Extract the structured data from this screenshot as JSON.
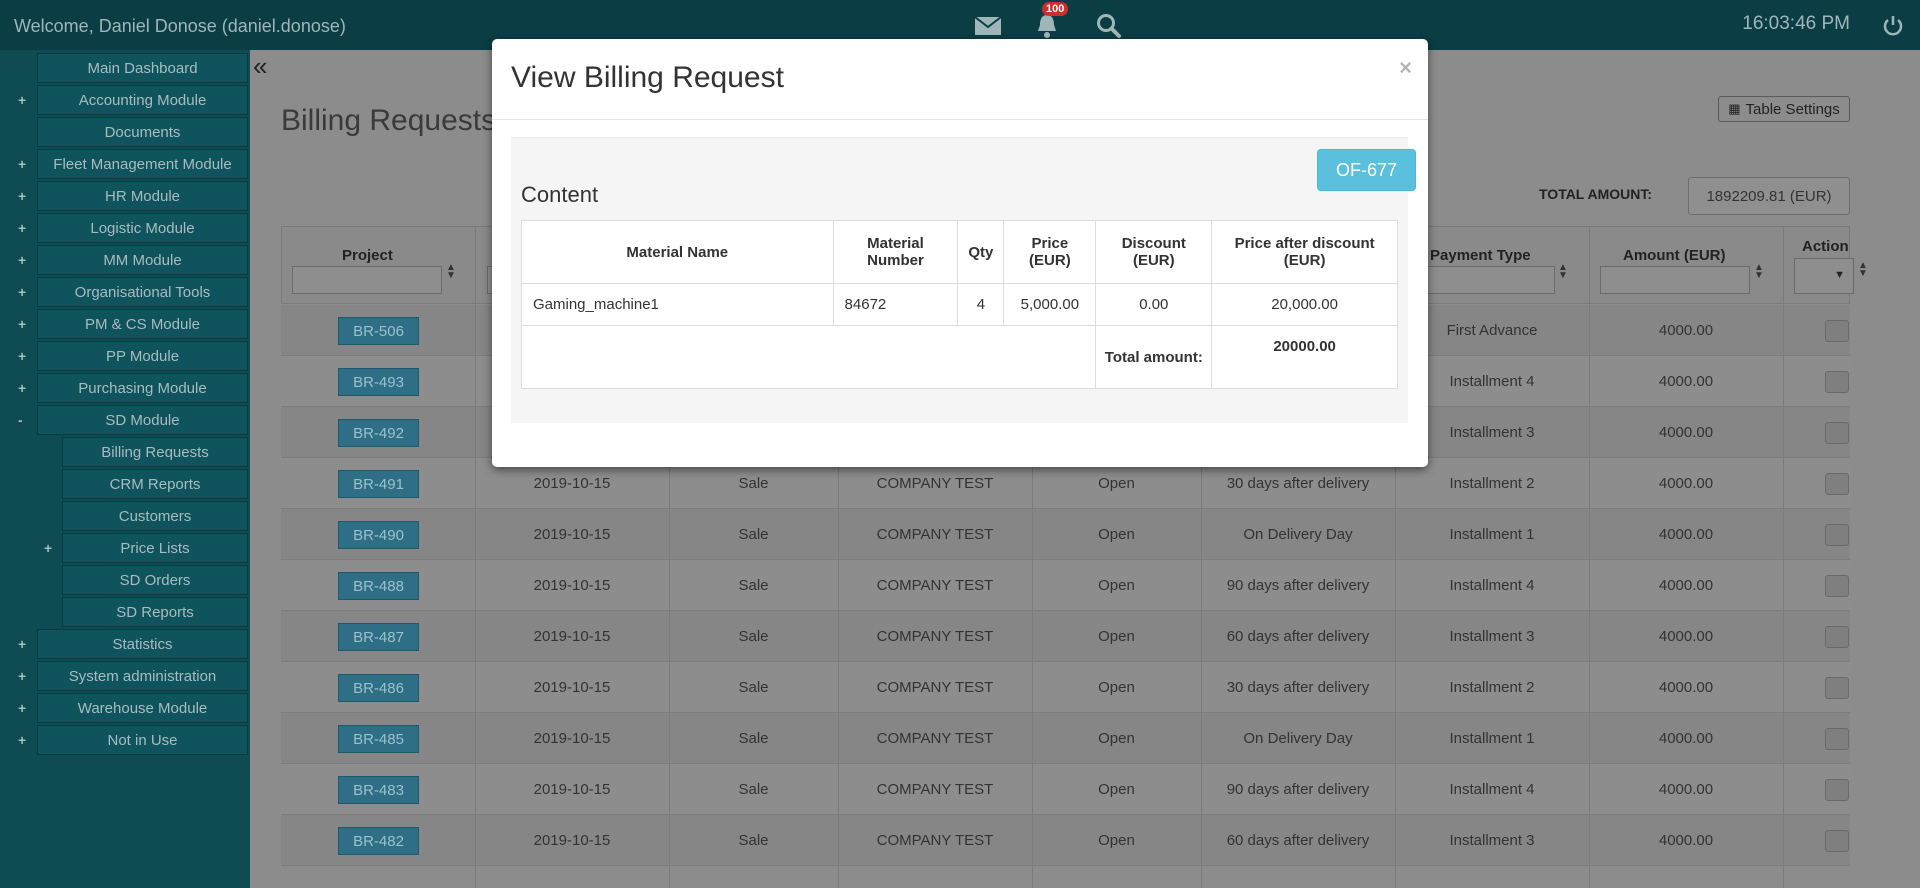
{
  "topbar": {
    "welcome": "Welcome, Daniel Donose (daniel.donose)",
    "clock": "16:03:46 PM",
    "notification_count": "100",
    "icons": [
      "mail-icon",
      "bell-icon",
      "search-icon",
      "power-icon"
    ]
  },
  "sidebar": {
    "items": [
      {
        "label": "Main Dashboard",
        "expandable": false
      },
      {
        "label": "Accounting Module",
        "expandable": true,
        "toggle": "+"
      },
      {
        "label": "Documents",
        "expandable": false
      },
      {
        "label": "Fleet Management Module",
        "expandable": true,
        "toggle": "+"
      },
      {
        "label": "HR Module",
        "expandable": true,
        "toggle": "+"
      },
      {
        "label": "Logistic Module",
        "expandable": true,
        "toggle": "+"
      },
      {
        "label": "MM Module",
        "expandable": true,
        "toggle": "+"
      },
      {
        "label": "Organisational Tools",
        "expandable": true,
        "toggle": "+"
      },
      {
        "label": "PM & CS Module",
        "expandable": true,
        "toggle": "+"
      },
      {
        "label": "PP Module",
        "expandable": true,
        "toggle": "+"
      },
      {
        "label": "Purchasing Module",
        "expandable": true,
        "toggle": "+"
      },
      {
        "label": "SD Module",
        "expandable": true,
        "toggle": "-"
      },
      {
        "label": "Statistics",
        "expandable": true,
        "toggle": "+"
      },
      {
        "label": "System administration",
        "expandable": true,
        "toggle": "+"
      },
      {
        "label": "Warehouse Module",
        "expandable": true,
        "toggle": "+"
      },
      {
        "label": "Not in Use",
        "expandable": true,
        "toggle": "+"
      }
    ],
    "sd_subitems": [
      {
        "label": "Billing Requests",
        "toggle": ""
      },
      {
        "label": "CRM Reports",
        "toggle": ""
      },
      {
        "label": "Customers",
        "toggle": ""
      },
      {
        "label": "Price Lists",
        "toggle": "+"
      },
      {
        "label": "SD Orders",
        "toggle": ""
      },
      {
        "label": "SD Reports",
        "toggle": ""
      }
    ]
  },
  "main": {
    "page_title": "Billing Requests",
    "table_settings": "Table Settings",
    "total_label": "TOTAL AMOUNT:",
    "total_value": "1892209.81   (EUR)",
    "headers": {
      "project": "Project",
      "payment_type": "Payment Type",
      "amount": "Amount (EUR)",
      "action": "Action"
    },
    "rows": [
      {
        "id": "BR-506",
        "date": "",
        "type": "",
        "company": "",
        "status": "",
        "terms": "",
        "payment": "First Advance",
        "amount": "4000.00"
      },
      {
        "id": "BR-493",
        "date": "",
        "type": "",
        "company": "",
        "status": "",
        "terms": "",
        "payment": "Installment 4",
        "amount": "4000.00"
      },
      {
        "id": "BR-492",
        "date": "",
        "type": "",
        "company": "",
        "status": "",
        "terms": "",
        "payment": "Installment 3",
        "amount": "4000.00"
      },
      {
        "id": "BR-491",
        "date": "2019-10-15",
        "type": "Sale",
        "company": "COMPANY TEST",
        "status": "Open",
        "terms": "30 days after delivery",
        "payment": "Installment 2",
        "amount": "4000.00"
      },
      {
        "id": "BR-490",
        "date": "2019-10-15",
        "type": "Sale",
        "company": "COMPANY TEST",
        "status": "Open",
        "terms": "On Delivery Day",
        "payment": "Installment 1",
        "amount": "4000.00"
      },
      {
        "id": "BR-488",
        "date": "2019-10-15",
        "type": "Sale",
        "company": "COMPANY TEST",
        "status": "Open",
        "terms": "90 days after delivery",
        "payment": "Installment 4",
        "amount": "4000.00"
      },
      {
        "id": "BR-487",
        "date": "2019-10-15",
        "type": "Sale",
        "company": "COMPANY TEST",
        "status": "Open",
        "terms": "60 days after delivery",
        "payment": "Installment 3",
        "amount": "4000.00"
      },
      {
        "id": "BR-486",
        "date": "2019-10-15",
        "type": "Sale",
        "company": "COMPANY TEST",
        "status": "Open",
        "terms": "30 days after delivery",
        "payment": "Installment 2",
        "amount": "4000.00"
      },
      {
        "id": "BR-485",
        "date": "2019-10-15",
        "type": "Sale",
        "company": "COMPANY TEST",
        "status": "Open",
        "terms": "On Delivery Day",
        "payment": "Installment 1",
        "amount": "4000.00"
      },
      {
        "id": "BR-483",
        "date": "2019-10-15",
        "type": "Sale",
        "company": "COMPANY TEST",
        "status": "Open",
        "terms": "90 days after delivery",
        "payment": "Installment 4",
        "amount": "4000.00"
      },
      {
        "id": "BR-482",
        "date": "2019-10-15",
        "type": "Sale",
        "company": "COMPANY TEST",
        "status": "Open",
        "terms": "60 days after delivery",
        "payment": "Installment 3",
        "amount": "4000.00"
      }
    ]
  },
  "modal": {
    "title": "View Billing Request",
    "close": "×",
    "reference_button": "OF-677",
    "content_title": "Content",
    "columns": {
      "material_name": "Material Name",
      "material_number": "Material Number",
      "qty": "Qty",
      "price": "Price (EUR)",
      "discount": "Discount (EUR)",
      "price_after_discount": "Price after discount (EUR)"
    },
    "items": [
      {
        "material_name": "Gaming_machine1",
        "material_number": "84672",
        "qty": "4",
        "price": "5,000.00",
        "discount": "0.00",
        "price_after_discount": "20,000.00"
      }
    ],
    "total_label": "Total amount:",
    "total_value": "20000.00"
  },
  "colors": {
    "topbar": "#0b3d44",
    "sidebar": "#0e4b53",
    "modal_button": "#5bc0de",
    "badge": "#c9302c"
  }
}
